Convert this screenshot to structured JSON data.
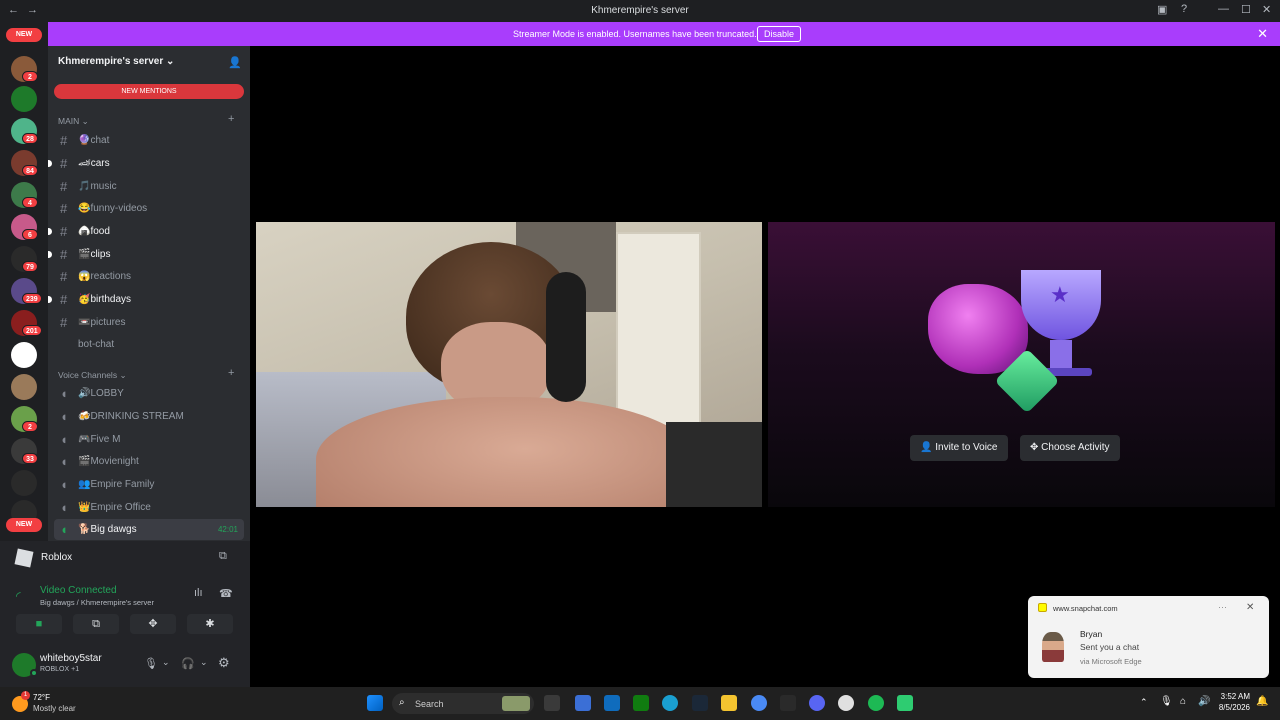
{
  "window": {
    "title": "Khmerempire's server"
  },
  "banner": {
    "message": "Streamer Mode is enabled. Usernames have been truncated.",
    "disable_label": "Disable"
  },
  "servers": {
    "new_label": "NEW",
    "badges": [
      "2",
      "28",
      "84",
      "4",
      "6",
      "79",
      "239",
      "201",
      "2",
      "33"
    ]
  },
  "sidebar": {
    "server_name": "Khmerempire's server",
    "new_mentions": "NEW MENTIONS",
    "main_category": "MAIN",
    "voice_category": "Voice Channels",
    "text_channels": [
      {
        "name": "chat",
        "emoji": "🔮"
      },
      {
        "name": "cars",
        "emoji": "🏎"
      },
      {
        "name": "music",
        "emoji": "🎵"
      },
      {
        "name": "funny-videos",
        "emoji": "😂"
      },
      {
        "name": "food",
        "emoji": "🍙"
      },
      {
        "name": "clips",
        "emoji": "🎬"
      },
      {
        "name": "reactions",
        "emoji": "😱"
      },
      {
        "name": "birthdays",
        "emoji": "🥳"
      },
      {
        "name": "pictures",
        "emoji": "📼"
      },
      {
        "name": "bot-chat",
        "emoji": ""
      }
    ],
    "voice_channels": [
      {
        "name": "LOBBY",
        "emoji": "🔊"
      },
      {
        "name": "DRINKING STREAM",
        "emoji": "🍻"
      },
      {
        "name": "Five M",
        "emoji": "🎮"
      },
      {
        "name": "Movienight",
        "emoji": "🎬"
      },
      {
        "name": "Empire Family",
        "emoji": "👥"
      },
      {
        "name": "Empire Office",
        "emoji": "👑"
      },
      {
        "name": "Big dawgs",
        "emoji": "🐕"
      }
    ],
    "active_timer": "42:01"
  },
  "activity": {
    "game": "Roblox"
  },
  "rtc": {
    "status": "Video Connected",
    "location": "Big dawgs / Khmerempire's server"
  },
  "user": {
    "name": "whiteboy5star",
    "status": "ROBLOX +1"
  },
  "stage": {
    "invite_label": "Invite to Voice",
    "activity_label": "Choose Activity"
  },
  "toast": {
    "source": "www.snapchat.com",
    "sender": "Bryan",
    "message": "Sent you a chat",
    "via": "via Microsoft Edge"
  },
  "taskbar": {
    "weather_temp": "72°F",
    "weather_desc": "Mostly clear",
    "weather_badge": "1",
    "search_placeholder": "Search",
    "time": "3:52 AM",
    "date": "8/5/2026"
  },
  "colors": {
    "accent": "#5865f2",
    "banner": "#a93dfc",
    "online": "#23a55a",
    "mention": "#da373c"
  }
}
